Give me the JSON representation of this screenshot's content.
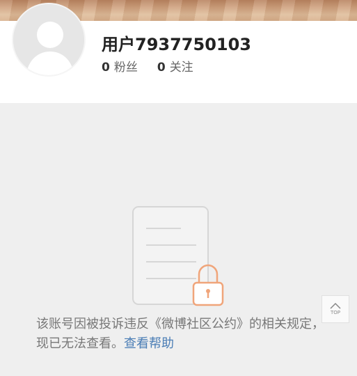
{
  "profile": {
    "username": "用户7937750103",
    "followers_count": "0",
    "followers_label": "粉丝",
    "following_count": "0",
    "following_label": "关注"
  },
  "notice": {
    "text": "该账号因被投诉违反《微博社区公约》的相关规定，现已无法查看。",
    "help_link": "查看帮助"
  },
  "top_button": {
    "label": "TOP"
  },
  "colors": {
    "link": "#4a7db5",
    "lock": "#f0a57a",
    "background": "#efefef"
  }
}
